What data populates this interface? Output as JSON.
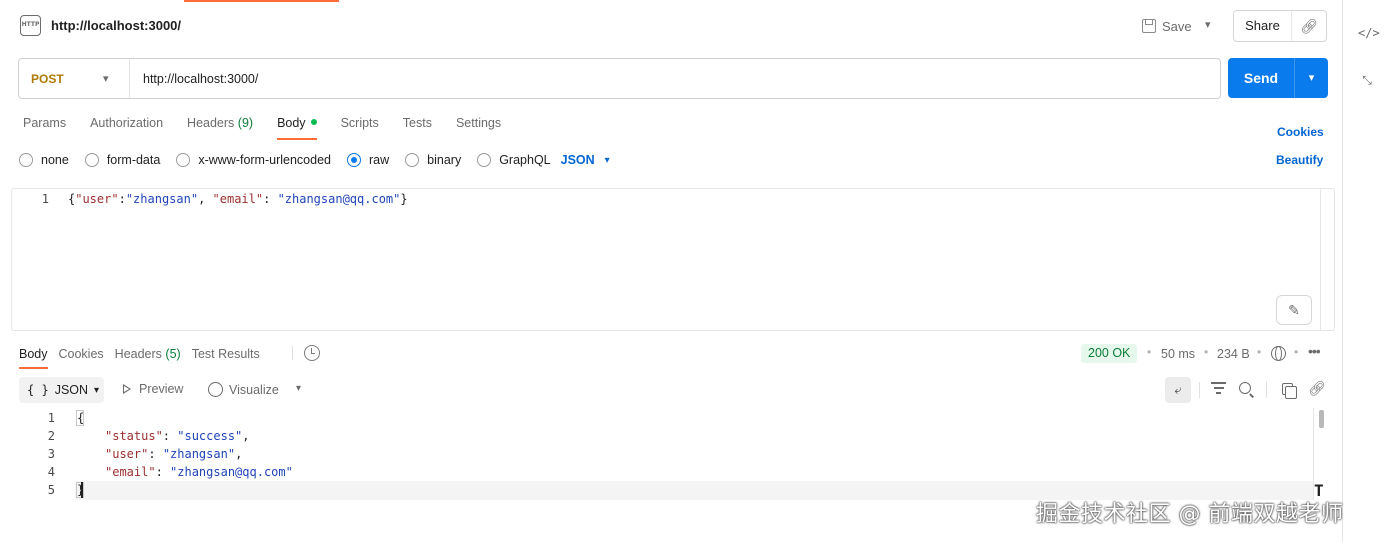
{
  "request": {
    "title": "http://localhost:3000/",
    "method": "POST",
    "url": "http://localhost:3000/",
    "save_label": "Save",
    "share_label": "Share",
    "send_label": "Send",
    "tabs": [
      {
        "label": "Params"
      },
      {
        "label": "Authorization"
      },
      {
        "label": "Headers",
        "count": "(9)"
      },
      {
        "label": "Body"
      },
      {
        "label": "Scripts"
      },
      {
        "label": "Tests"
      },
      {
        "label": "Settings"
      }
    ],
    "active_tab": "Body",
    "cookies_label": "Cookies",
    "beautify_label": "Beautify",
    "body_types": [
      "none",
      "form-data",
      "x-www-form-urlencoded",
      "raw",
      "binary",
      "GraphQL"
    ],
    "selected_body_type": "raw",
    "language": "JSON",
    "body_code": {
      "line_number": "1",
      "open": "{",
      "k1": "\"user\"",
      "colon1": ":",
      "v1": "\"zhangsan\"",
      "comma": ", ",
      "k2": "\"email\"",
      "colon2": ": ",
      "v2": "\"zhangsan@qq.com\"",
      "close": "}"
    }
  },
  "response": {
    "tabs": [
      {
        "label": "Body"
      },
      {
        "label": "Cookies"
      },
      {
        "label": "Headers",
        "count": "(5)"
      },
      {
        "label": "Test Results"
      }
    ],
    "status": "200 OK",
    "time": "50 ms",
    "size": "234 B",
    "format": "JSON",
    "preview_label": "Preview",
    "visualize_label": "Visualize",
    "lines": [
      {
        "n": "1",
        "text": "{"
      },
      {
        "n": "2",
        "key": "\"status\"",
        "sep": ": ",
        "val": "\"success\"",
        "end": ","
      },
      {
        "n": "3",
        "key": "\"user\"",
        "sep": ": ",
        "val": "\"zhangsan\"",
        "end": ","
      },
      {
        "n": "4",
        "key": "\"email\"",
        "sep": ": ",
        "val": "\"zhangsan@qq.com\"",
        "end": ""
      },
      {
        "n": "5",
        "text": "}"
      }
    ]
  },
  "watermark": "掘金技术社区 @ 前端双越老师",
  "colors": {
    "accent": "#ff6c37",
    "send": "#097bed",
    "link": "#0265d2",
    "method_post": "#ad7a03",
    "status_ok": "#0a7d38"
  }
}
